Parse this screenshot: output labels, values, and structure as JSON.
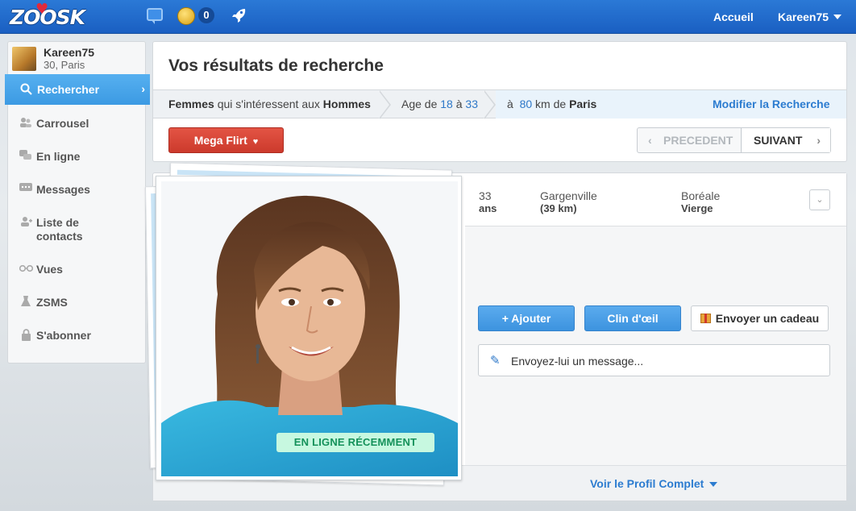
{
  "header": {
    "logo": "ZOOSK",
    "coins_count": "0",
    "nav_home": "Accueil",
    "nav_user": "Kareen75"
  },
  "sidebar": {
    "profile": {
      "name": "Kareen75",
      "location": "30, Paris"
    },
    "items": [
      {
        "label": "Rechercher",
        "icon": "search-icon",
        "active": true
      },
      {
        "label": "Carrousel",
        "icon": "carousel-icon"
      },
      {
        "label": "En ligne",
        "icon": "online-chat-icon"
      },
      {
        "label": "Messages",
        "icon": "messages-icon"
      },
      {
        "label": "Liste de contacts",
        "icon": "contacts-icon"
      },
      {
        "label": "Vues",
        "icon": "glasses-icon"
      },
      {
        "label": "ZSMS",
        "icon": "zsms-icon"
      },
      {
        "label": "S'abonner",
        "icon": "lock-icon"
      }
    ]
  },
  "search": {
    "title": "Vos résultats de recherche",
    "crumb_gender_a": "Femmes",
    "crumb_gender_mid": "qui s'intéressent aux",
    "crumb_gender_b": "Hommes",
    "crumb_age_prefix": "Age de",
    "age_min": "18",
    "age_sep": "à",
    "age_max": "33",
    "crumb_dist_prefix": "à",
    "distance": "80",
    "crumb_dist_mid": "km de",
    "city": "Paris",
    "modify_label": "Modifier la Recherche",
    "mega_flirt_label": "Mega Flirt",
    "prev_label": "PRECEDENT",
    "next_label": "SUIVANT"
  },
  "profile": {
    "age": "33",
    "age_unit": "ans",
    "town": "Gargenville",
    "distance": "(39 km)",
    "sign_a": "Boréale",
    "sign_b": "Vierge",
    "status_badge": "EN LIGNE RÉCEMMENT",
    "add_label": "+ Ajouter",
    "wink_label": "Clin d'œil",
    "gift_label": "Envoyer un cadeau",
    "message_placeholder": "Envoyez-lui un message...",
    "full_profile_label": "Voir le Profil Complet"
  },
  "colors": {
    "topbar": "#1f67c9",
    "accent_blue": "#3c9ae3",
    "mega_flirt_red": "#d9463a",
    "online_green": "#14915a"
  }
}
